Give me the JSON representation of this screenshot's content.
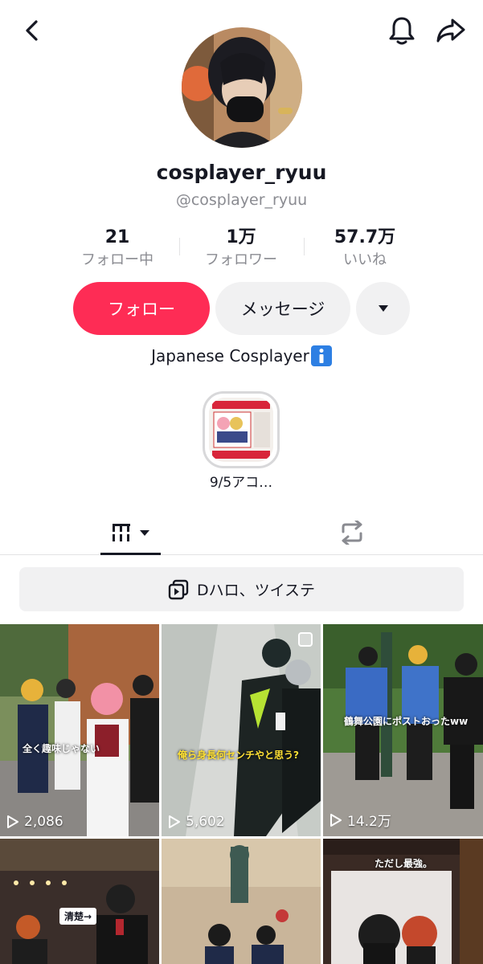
{
  "profile": {
    "username": "cosplayer_ryuu",
    "handle": "@cosplayer_ryuu",
    "bio": "Japanese Cosplayer"
  },
  "stats": [
    {
      "value": "21",
      "label": "フォロー中"
    },
    {
      "value": "1万",
      "label": "フォロワー"
    },
    {
      "value": "57.7万",
      "label": "いいね"
    }
  ],
  "actions": {
    "follow": "フォロー",
    "message": "メッセージ"
  },
  "highlight": {
    "label": "9/5アコ…"
  },
  "playlist": {
    "label": "Dハロ、ツイステ"
  },
  "videos": [
    {
      "views": "2,086",
      "caption": "全く趣味じゃない"
    },
    {
      "views": "5,602",
      "caption": "俺ら身長何センチやと思う?"
    },
    {
      "views": "14.2万",
      "caption": "鶴舞公園にポストおったww"
    },
    {
      "views": "",
      "caption": "清楚→"
    },
    {
      "views": "",
      "caption": ""
    },
    {
      "views": "",
      "caption": "ただし最強。"
    }
  ],
  "colors": {
    "accent": "#fe2c55",
    "text": "#161823",
    "muted": "#8a8b91",
    "button_bg": "#f1f1f2"
  }
}
